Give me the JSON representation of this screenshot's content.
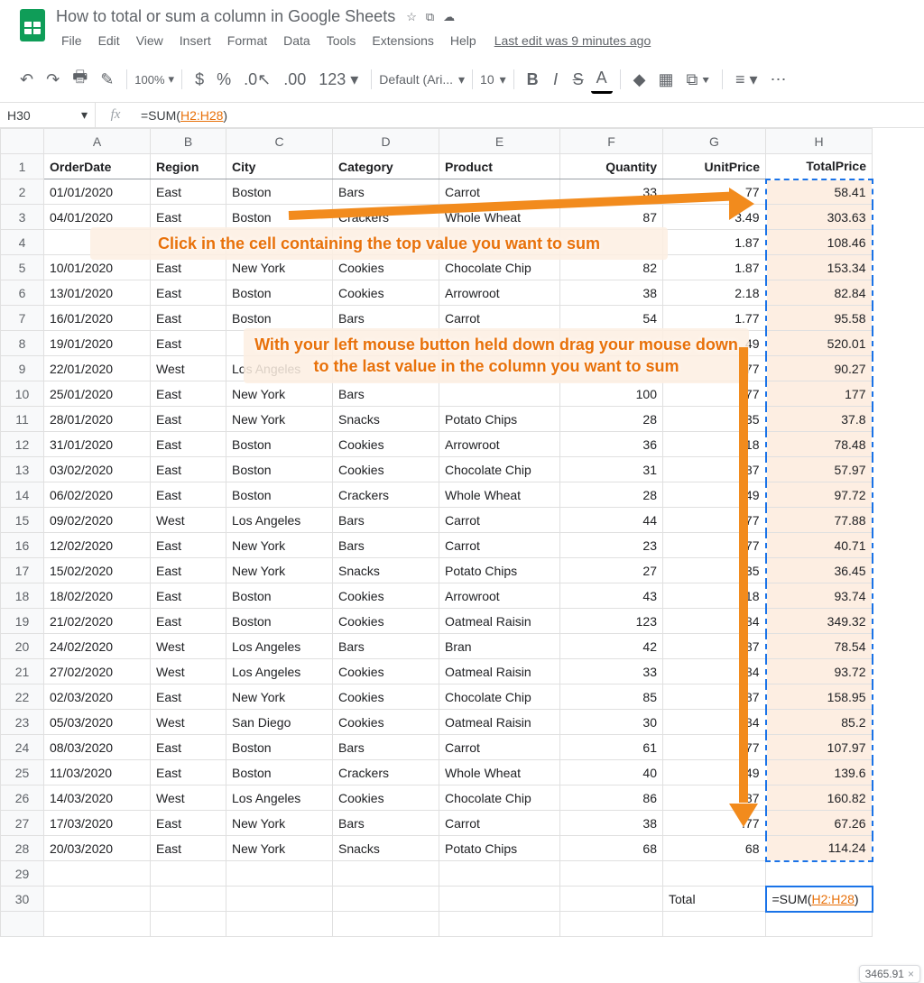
{
  "doc": {
    "title": "How to total or sum a column in Google Sheets",
    "last_edit": "Last edit was 9 minutes ago"
  },
  "menus": [
    "File",
    "Edit",
    "View",
    "Insert",
    "Format",
    "Data",
    "Tools",
    "Extensions",
    "Help"
  ],
  "toolbar": {
    "zoom": "100%",
    "font": "Default (Ari...",
    "size": "10"
  },
  "namebox": "H30",
  "formula_prefix": "=SUM(",
  "formula_range": "H2:H28",
  "formula_suffix": ")",
  "columns": [
    "A",
    "B",
    "C",
    "D",
    "E",
    "F",
    "G",
    "H"
  ],
  "headers": [
    "OrderDate",
    "Region",
    "City",
    "Category",
    "Product",
    "Quantity",
    "UnitPrice",
    "TotalPrice"
  ],
  "rows": [
    [
      "01/01/2020",
      "East",
      "Boston",
      "Bars",
      "Carrot",
      "33",
      "77",
      "58.41"
    ],
    [
      "04/01/2020",
      "East",
      "Boston",
      "Crackers",
      "Whole Wheat",
      "87",
      "3.49",
      "303.63"
    ],
    [
      "",
      "",
      "",
      "",
      "",
      "",
      "1.87",
      "108.46"
    ],
    [
      "10/01/2020",
      "East",
      "New York",
      "Cookies",
      "Chocolate Chip",
      "82",
      "1.87",
      "153.34"
    ],
    [
      "13/01/2020",
      "East",
      "Boston",
      "Cookies",
      "Arrowroot",
      "38",
      "2.18",
      "82.84"
    ],
    [
      "16/01/2020",
      "East",
      "Boston",
      "Bars",
      "Carrot",
      "54",
      "1.77",
      "95.58"
    ],
    [
      "19/01/2020",
      "East",
      "",
      "",
      "",
      "",
      "49",
      "520.01"
    ],
    [
      "22/01/2020",
      "West",
      "Los Angeles",
      "",
      "",
      "",
      ".77",
      "90.27"
    ],
    [
      "25/01/2020",
      "East",
      "New York",
      "Bars",
      "",
      "100",
      ".77",
      "177"
    ],
    [
      "28/01/2020",
      "East",
      "New York",
      "Snacks",
      "Potato Chips",
      "28",
      ".35",
      "37.8"
    ],
    [
      "31/01/2020",
      "East",
      "Boston",
      "Cookies",
      "Arrowroot",
      "36",
      ".18",
      "78.48"
    ],
    [
      "03/02/2020",
      "East",
      "Boston",
      "Cookies",
      "Chocolate Chip",
      "31",
      ".87",
      "57.97"
    ],
    [
      "06/02/2020",
      "East",
      "Boston",
      "Crackers",
      "Whole Wheat",
      "28",
      ".49",
      "97.72"
    ],
    [
      "09/02/2020",
      "West",
      "Los Angeles",
      "Bars",
      "Carrot",
      "44",
      ".77",
      "77.88"
    ],
    [
      "12/02/2020",
      "East",
      "New York",
      "Bars",
      "Carrot",
      "23",
      ".77",
      "40.71"
    ],
    [
      "15/02/2020",
      "East",
      "New York",
      "Snacks",
      "Potato Chips",
      "27",
      ".35",
      "36.45"
    ],
    [
      "18/02/2020",
      "East",
      "Boston",
      "Cookies",
      "Arrowroot",
      "43",
      ".18",
      "93.74"
    ],
    [
      "21/02/2020",
      "East",
      "Boston",
      "Cookies",
      "Oatmeal Raisin",
      "123",
      ".84",
      "349.32"
    ],
    [
      "24/02/2020",
      "West",
      "Los Angeles",
      "Bars",
      "Bran",
      "42",
      ".87",
      "78.54"
    ],
    [
      "27/02/2020",
      "West",
      "Los Angeles",
      "Cookies",
      "Oatmeal Raisin",
      "33",
      ".84",
      "93.72"
    ],
    [
      "02/03/2020",
      "East",
      "New York",
      "Cookies",
      "Chocolate Chip",
      "85",
      ".87",
      "158.95"
    ],
    [
      "05/03/2020",
      "West",
      "San Diego",
      "Cookies",
      "Oatmeal Raisin",
      "30",
      ".84",
      "85.2"
    ],
    [
      "08/03/2020",
      "East",
      "Boston",
      "Bars",
      "Carrot",
      "61",
      ".77",
      "107.97"
    ],
    [
      "11/03/2020",
      "East",
      "Boston",
      "Crackers",
      "Whole Wheat",
      "40",
      ".49",
      "139.6"
    ],
    [
      "14/03/2020",
      "West",
      "Los Angeles",
      "Cookies",
      "Chocolate Chip",
      "86",
      ".87",
      "160.82"
    ],
    [
      "17/03/2020",
      "East",
      "New York",
      "Bars",
      "Carrot",
      "38",
      ".77",
      "67.26"
    ],
    [
      "20/03/2020",
      "East",
      "New York",
      "Snacks",
      "Potato Chips",
      "68",
      "68",
      "114.24"
    ]
  ],
  "total_label_row": {
    "row": 30,
    "label_col": "G",
    "label": "Total"
  },
  "formula_cell_display_prefix": "=SUM(",
  "formula_cell_display_range": "H2:H28",
  "formula_cell_display_suffix": ")",
  "result_popup": "3465.91",
  "annotation1": "Click in the cell containing the top value you want to sum",
  "annotation2": "With your left mouse button held down drag your mouse down to the last value in the column you want to sum"
}
